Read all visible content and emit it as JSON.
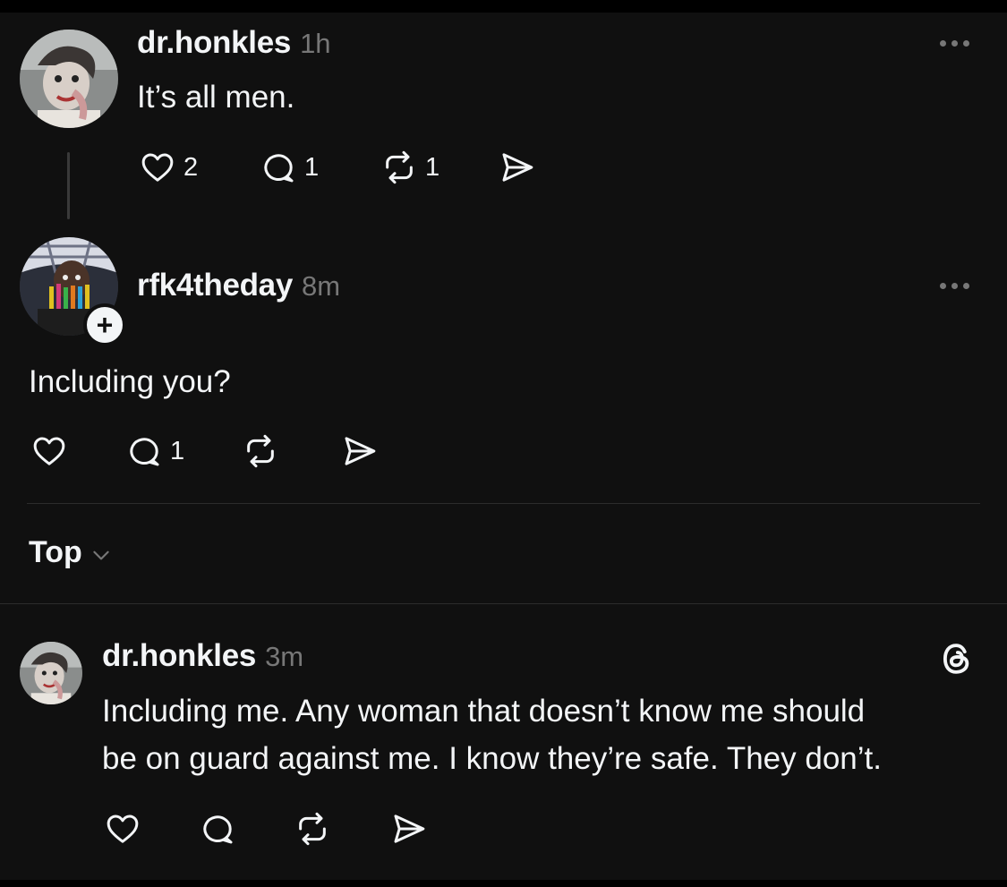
{
  "posts": [
    {
      "username": "dr.honkles",
      "time": "1h",
      "text": "It’s all men.",
      "likes": "2",
      "replies": "1",
      "reposts": "1"
    },
    {
      "username": "rfk4theday",
      "time": "8m",
      "text": "Including you?",
      "likes": "",
      "replies": "1",
      "reposts": ""
    }
  ],
  "sort": {
    "label": "Top"
  },
  "reply": {
    "username": "dr.honkles",
    "time": "3m",
    "text_line1": "Including me. Any woman that doesn’t know me should",
    "text_line2": "be on guard against me. I know they’re safe. They don’t."
  },
  "colors": {
    "background": "#101010",
    "text": "#f3f5f7",
    "muted": "#777777",
    "divider": "#2c2c2c"
  },
  "icons": [
    "heart-icon",
    "comment-icon",
    "repost-icon",
    "share-icon",
    "more-icon",
    "plus-icon",
    "chevron-down-icon",
    "threads-logo-icon"
  ]
}
